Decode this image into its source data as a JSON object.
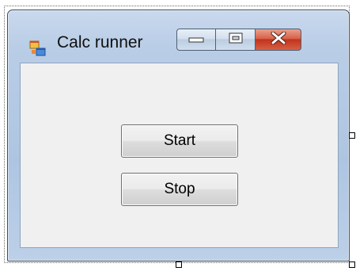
{
  "window": {
    "title": "Calc runner",
    "app_icon": "form-icon",
    "caption_buttons": {
      "minimize_icon": "minimize-icon",
      "maximize_icon": "maximize-icon",
      "close_icon": "close-icon"
    }
  },
  "buttons": {
    "start_label": "Start",
    "stop_label": "Stop"
  },
  "colors": {
    "window_frame": "#b9cde6",
    "client_background": "#f0f0f0",
    "close_button": "#c1331b",
    "button_face": "#e5e5e5"
  }
}
